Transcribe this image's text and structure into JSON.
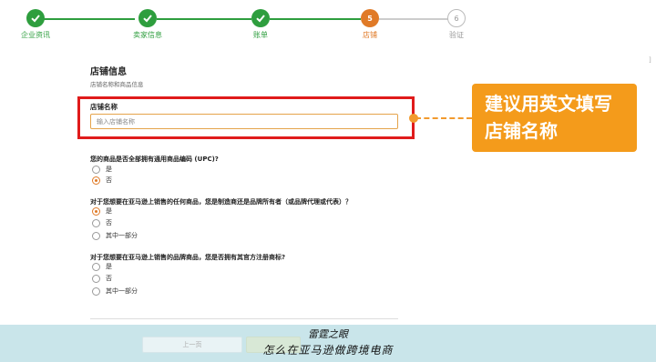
{
  "stepper": {
    "steps": [
      {
        "label": "企业资讯",
        "number": "",
        "state": "done"
      },
      {
        "label": "卖家信息",
        "number": "",
        "state": "done"
      },
      {
        "label": "账单",
        "number": "",
        "state": "done"
      },
      {
        "label": "店铺",
        "number": "5",
        "state": "current"
      },
      {
        "label": "验证",
        "number": "6",
        "state": "todo"
      }
    ],
    "colors": {
      "done": "#2e9e3e",
      "current": "#e07a27",
      "todo": "#bbbbbb"
    }
  },
  "form": {
    "title": "店铺信息",
    "subtitle": "店铺名称和商品信息",
    "store_name": {
      "label": "店铺名称",
      "placeholder": "输入店铺名称",
      "value": ""
    },
    "questions": [
      {
        "text": "您的商品是否全部拥有通用商品编码 (UPC)?",
        "options": [
          "是",
          "否"
        ],
        "selected": 1
      },
      {
        "text": "对于您想要在亚马逊上销售的任何商品，您是制造商还是品牌所有者（或品牌代理或代表）？",
        "options": [
          "是",
          "否",
          "其中一部分"
        ],
        "selected": 0
      },
      {
        "text": "对于您想要在亚马逊上销售的品牌商品，您是否拥有其官方注册商标?",
        "options": [
          "是",
          "否",
          "其中一部分"
        ],
        "selected": -1
      }
    ]
  },
  "callout": {
    "line1": "建议用英文填写",
    "line2": "店铺名称",
    "color": "#f49b1b"
  },
  "footer": {
    "prev_label": "上一页",
    "next_label": "",
    "watermark_line1": "雷霆之眼",
    "watermark_line2": "怎么在亚马逊做跨境电商"
  },
  "edge_mark": "]"
}
